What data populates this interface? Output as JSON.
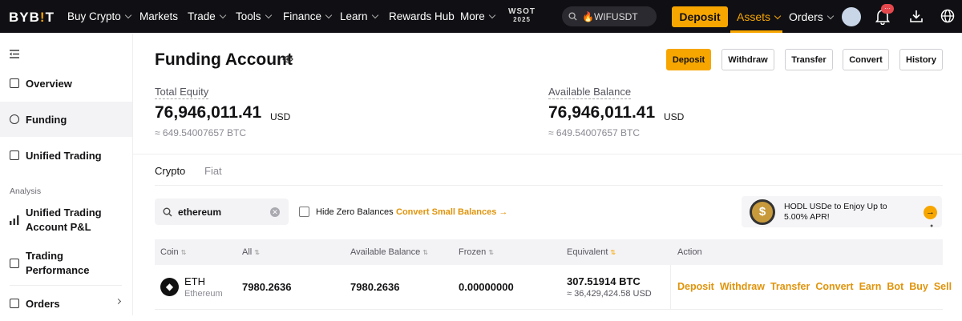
{
  "nav": {
    "logo_pre": "BYB",
    "logo_accent": "!",
    "logo_post": "T",
    "items": [
      "Buy Crypto",
      "Markets",
      "Trade",
      "Tools",
      "Finance",
      "Learn",
      "Rewards Hub",
      "More"
    ],
    "event_badge_line1": "WSOT",
    "event_badge_line2": "2025",
    "search_text": "🔥WIFUSDT",
    "deposit_label": "Deposit",
    "assets_label": "Assets",
    "orders_label": "Orders",
    "notification_count": "···",
    "accent_color": "#f7a600"
  },
  "sidebar": {
    "items": [
      {
        "label": "Overview",
        "icon": "grid-icon"
      },
      {
        "label": "Funding",
        "icon": "coin-icon"
      },
      {
        "label": "Unified Trading",
        "icon": "wallet-icon"
      }
    ],
    "section_label": "Analysis",
    "analysis_items": [
      {
        "line1": "Unified Trading",
        "line2": "Account P&L"
      },
      {
        "line1": "Trading",
        "line2": "Performance"
      }
    ],
    "orders_label": "Orders"
  },
  "header": {
    "title": "Funding Account",
    "buttons": [
      "Deposit",
      "Withdraw",
      "Transfer",
      "Convert",
      "History"
    ]
  },
  "balances": {
    "total_equity_label": "Total Equity",
    "total_equity_value": "76,946,011.41",
    "total_equity_unit": "USD",
    "total_equity_btc": "≈ 649.54007657 BTC",
    "available_label": "Available Balance",
    "available_value": "76,946,011.41",
    "available_unit": "USD",
    "available_btc": "≈ 649.54007657 BTC"
  },
  "tabs": [
    "Crypto",
    "Fiat"
  ],
  "filters": {
    "search_value": "ethereum",
    "hide_zero_label": "Hide Zero Balances",
    "hide_zero_checked": false,
    "convert_small_label": "Convert Small Balances →"
  },
  "promo": {
    "text": "HODL USDe to Enjoy Up to 5.00% APR!"
  },
  "table": {
    "columns": [
      "Coin",
      "All",
      "Available Balance",
      "Frozen",
      "Equivalent",
      "Action"
    ],
    "rows": [
      {
        "symbol": "ETH",
        "name": "Ethereum",
        "all": "7980.2636",
        "available": "7980.2636",
        "frozen": "0.00000000",
        "equivalent_btc": "307.51914 BTC",
        "equivalent_usd": "≈ 36,429,424.58 USD",
        "actions": [
          "Deposit",
          "Withdraw",
          "Transfer",
          "Convert",
          "Earn",
          "Bot",
          "Buy",
          "Sell"
        ]
      }
    ]
  }
}
